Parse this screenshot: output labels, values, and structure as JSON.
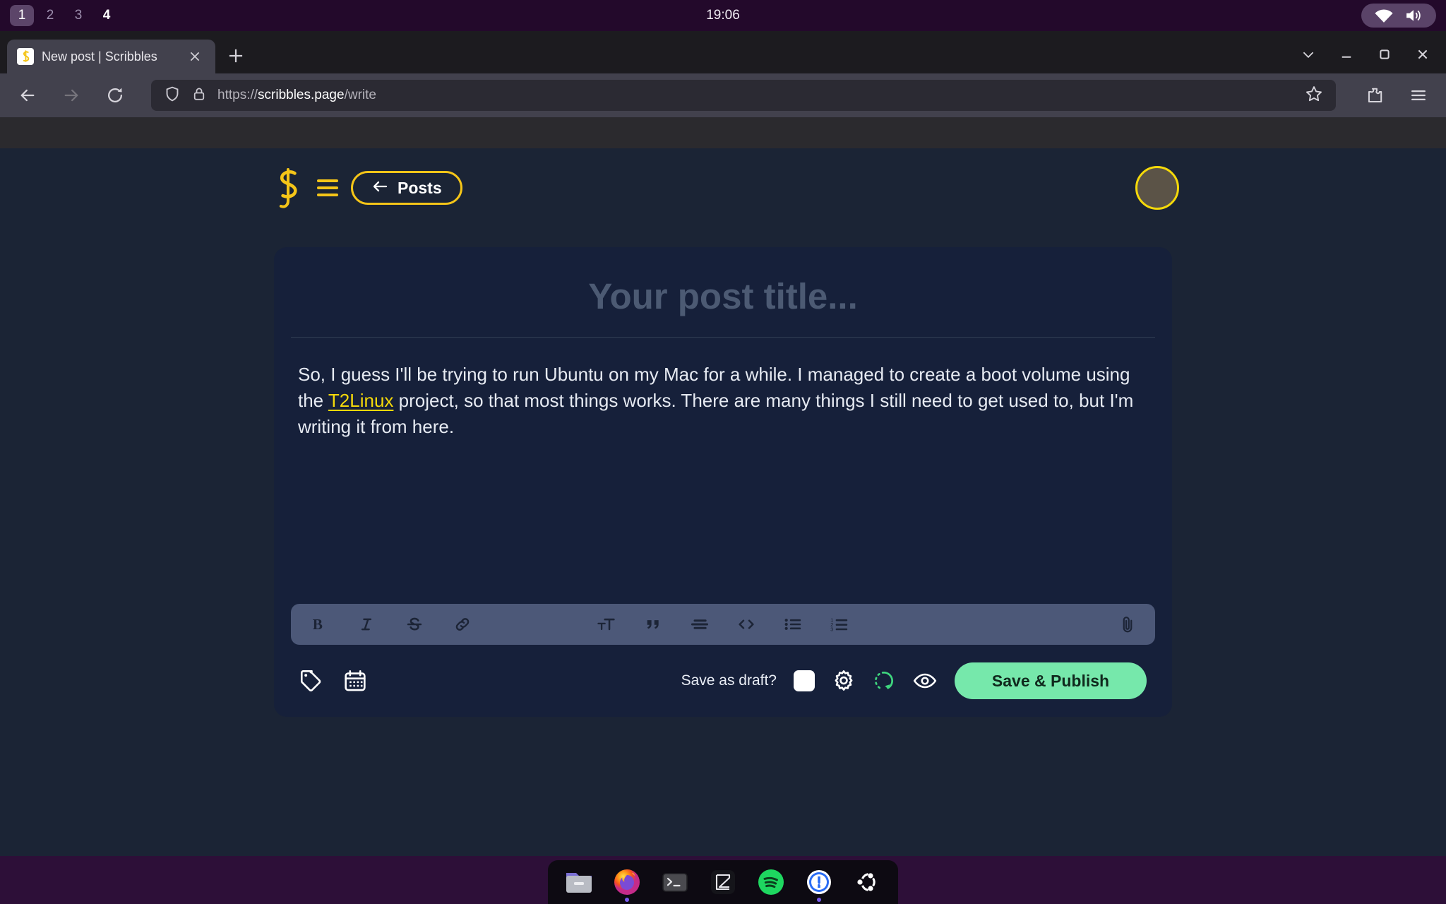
{
  "desktop": {
    "workspaces": [
      {
        "label": "1",
        "active": true
      },
      {
        "label": "2",
        "active": false
      },
      {
        "label": "3",
        "active": false
      },
      {
        "label": "4",
        "active": false
      }
    ],
    "clock": "19:06",
    "tray": {
      "wifi_icon": "wifi-icon",
      "volume_icon": "volume-icon"
    }
  },
  "browser": {
    "tab": {
      "title": "New post | Scribbles",
      "favicon": "scribbles-favicon",
      "close_icon": "close-icon"
    },
    "new_tab_label": "+",
    "window_controls": {
      "list_all_tabs_icon": "chevron-down-icon",
      "minimize_icon": "minimize-icon",
      "maximize_icon": "maximize-icon",
      "close_icon": "close-icon"
    },
    "nav": {
      "back_icon": "back-arrow-icon",
      "forward_icon": "forward-arrow-icon",
      "reload_icon": "reload-icon"
    },
    "url": {
      "scheme": "https://",
      "host": "scribbles.page",
      "path": "/write",
      "full": "https://scribbles.page/write",
      "shield_icon": "shield-icon",
      "lock_icon": "lock-icon",
      "bookmark_icon": "star-icon"
    },
    "toolbar": {
      "extensions_icon": "extensions-icon",
      "menu_icon": "hamburger-menu-icon"
    }
  },
  "app": {
    "header": {
      "logo": "scribbles-logo",
      "menu_icon": "hamburger-icon",
      "posts_button": "Posts",
      "back_arrow_icon": "left-arrow-icon",
      "avatar": "user-avatar"
    },
    "editor": {
      "title_placeholder": "Your post title...",
      "body": {
        "before_link": "So, I guess I'll be trying to run Ubuntu on my Mac for a while. I managed to create a boot volume using the ",
        "link_text": "T2Linux",
        "after_link": " project, so that most things works. There are many things I still need to get used to, but I'm writing it from here."
      }
    },
    "format_toolbar": {
      "left": [
        "bold-icon",
        "italic-icon",
        "strikethrough-icon",
        "link-icon"
      ],
      "middle": [
        "heading-icon",
        "blockquote-icon",
        "horizontal-rule-icon",
        "code-icon",
        "bullet-list-icon",
        "numbered-list-icon"
      ],
      "right": [
        "attachment-icon"
      ]
    },
    "actions": {
      "tag_icon": "tag-icon",
      "calendar_icon": "calendar-icon",
      "draft_label": "Save as draft?",
      "draft_checked": false,
      "settings_icon": "gear-icon",
      "sync_icon": "sync-spinner-icon",
      "preview_icon": "eye-icon",
      "publish_label": "Save & Publish"
    }
  },
  "dock": {
    "items": [
      {
        "name": "files",
        "running": false
      },
      {
        "name": "firefox",
        "running": true
      },
      {
        "name": "terminal",
        "running": false
      },
      {
        "name": "zed",
        "running": false
      },
      {
        "name": "spotify",
        "running": false
      },
      {
        "name": "1password",
        "running": true
      },
      {
        "name": "ubuntu-software",
        "running": false
      }
    ]
  },
  "colors": {
    "accent_yellow": "#f5d90a",
    "publish_green": "#76e8ab",
    "page_bg": "#1b2435",
    "card_bg": "#16203a",
    "toolbar_bg": "#4c5878",
    "desktop_purple": "#23092b"
  }
}
